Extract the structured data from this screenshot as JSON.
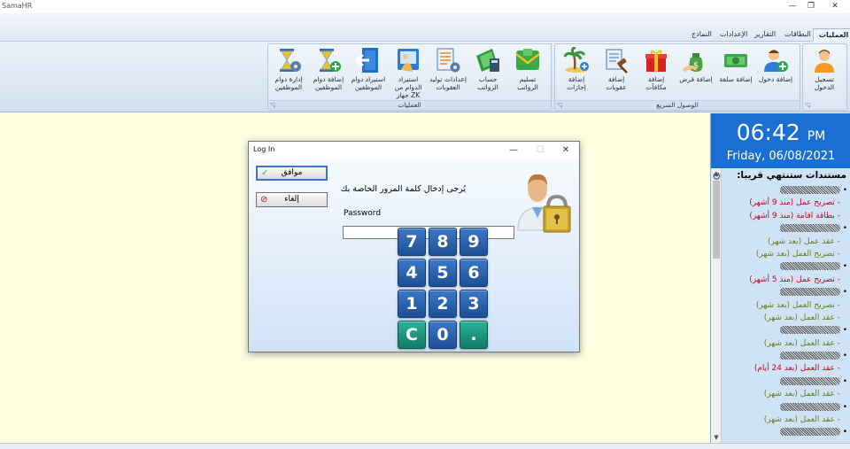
{
  "app": {
    "title": "SamaHR",
    "controls": {
      "minimize": "—",
      "maximize": "❐",
      "close": "✕"
    }
  },
  "ribbon": {
    "tabs": [
      {
        "label": "العمليات",
        "active": true
      },
      {
        "label": "البطاقات",
        "active": false
      },
      {
        "label": "التقارير",
        "active": false
      },
      {
        "label": "الإعدادات",
        "active": false
      },
      {
        "label": "النماذج",
        "active": false
      }
    ],
    "groups": {
      "login": {
        "buttons": [
          {
            "label": "تسجيل الدخول",
            "icon": "user-icon"
          }
        ]
      },
      "quick_access": {
        "label": "الوصول السريع",
        "buttons": [
          {
            "label": "إضافة دخول",
            "icon": "user-add-icon"
          },
          {
            "label": "إضافة سلفة",
            "icon": "money-icon"
          },
          {
            "label": "إضافة قرض",
            "icon": "money-bag-icon"
          },
          {
            "label": "إضافة مكافآت",
            "icon": "gift-icon"
          },
          {
            "label": "إضافة عقوبات",
            "icon": "gavel-icon"
          },
          {
            "label": "إضافة إجازات",
            "icon": "palm-tree-icon"
          }
        ]
      },
      "operations": {
        "label": "العمليات",
        "buttons": [
          {
            "label": "تسليم الرواتب",
            "icon": "salary-envelope-icon"
          },
          {
            "label": "حساب الرواتب",
            "icon": "calculator-icon"
          },
          {
            "label": "إعدادات توليد العقوبات",
            "icon": "document-settings-icon"
          },
          {
            "label": "استيراد الدوام من جهاز ZK",
            "icon": "fingerprint-device-icon"
          },
          {
            "label": "استيراد دوام الموظفين",
            "icon": "import-icon"
          },
          {
            "label": "إضافة دوام الموظفين",
            "icon": "hourglass-add-icon"
          },
          {
            "label": "إدارة دوام الموظفين",
            "icon": "hourglass-settings-icon"
          }
        ]
      }
    }
  },
  "side_panel": {
    "time": "06:42",
    "ampm": "PM",
    "date": "Friday, 06/08/2021",
    "docs_title": "مستندات ستنتهي قريبا:",
    "docs": [
      {
        "type": "name",
        "text": "•"
      },
      {
        "type": "red",
        "text": "- تصريح عمل (منذ 9 أشهر)"
      },
      {
        "type": "red",
        "text": "- بطاقة اقامة (منذ 9 أشهر)"
      },
      {
        "type": "name",
        "text": "•"
      },
      {
        "type": "green",
        "text": "- عقد عمل (بعد شهر)"
      },
      {
        "type": "green",
        "text": "- تصريح العمل (بعد شهر)"
      },
      {
        "type": "name",
        "text": "•"
      },
      {
        "type": "red",
        "text": "- تصريح عمل (منذ 5 أشهر)"
      },
      {
        "type": "name",
        "text": "•"
      },
      {
        "type": "green",
        "text": "- تصريح العمل (بعد شهر)"
      },
      {
        "type": "green",
        "text": "- عقد العمل (بعد شهر)"
      },
      {
        "type": "name",
        "text": "•"
      },
      {
        "type": "green",
        "text": "- عقد العمل (بعد شهر)"
      },
      {
        "type": "name",
        "text": "•"
      },
      {
        "type": "red",
        "text": "- عقد العمل (بعد 24 أيام)"
      },
      {
        "type": "name",
        "text": "•"
      },
      {
        "type": "green",
        "text": "- عقد العمل (بعد شهر)"
      },
      {
        "type": "name",
        "text": "•"
      },
      {
        "type": "green",
        "text": "- عقد العمل (بعد شهر)"
      },
      {
        "type": "name",
        "text": "•"
      }
    ]
  },
  "dialog": {
    "title": "Log In",
    "ok_label": "موافق",
    "cancel_label": "إلغاء",
    "prompt": "يُرجى إدخال كلمة المرور الخاصة بك",
    "password_label": "Password",
    "password_value": "",
    "keys": [
      "7",
      "8",
      "9",
      "4",
      "5",
      "6",
      "1",
      "2",
      "3",
      "C",
      "0",
      "."
    ]
  }
}
